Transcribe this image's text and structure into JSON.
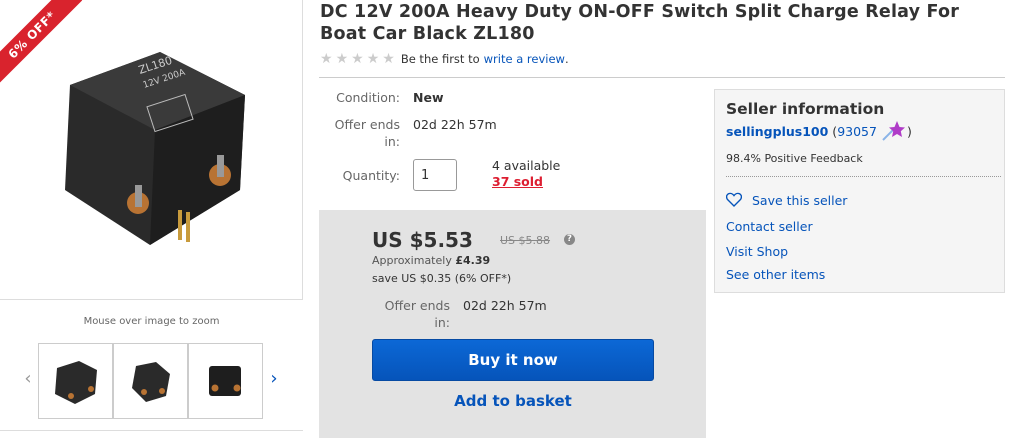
{
  "image": {
    "ribbon": "6% OFF*",
    "zoom_hint": "Mouse over image to zoom",
    "relay_top_label": "ZL180",
    "relay_sub_label": "12V 200A"
  },
  "title": "DC 12V 200A Heavy Duty ON-OFF Switch Split Charge Relay For Boat Car Black ZL180",
  "rating": {
    "stars": 5,
    "prefix": "Be the first to",
    "link": "write a review",
    "suffix": "."
  },
  "details": {
    "condition_label": "Condition:",
    "condition_value": "New",
    "offer_label_1": "Offer ends",
    "offer_label_2": "in:",
    "offer_value": "02d 22h 57m",
    "quantity_label": "Quantity:",
    "quantity_value": "1",
    "available": "4 available",
    "sold": "37 sold"
  },
  "price": {
    "main": "US $5.53",
    "was": "US $5.88",
    "approx_prefix": "Approximately",
    "approx_value": "£4.39",
    "save": "save US $0.35 (6% OFF*)",
    "offer_label_1": "Offer ends",
    "offer_label_2": "in:",
    "offer_value": "02d 22h 57m",
    "buy_now": "Buy it now",
    "add_basket": "Add to basket"
  },
  "seller": {
    "title": "Seller information",
    "name": "sellingplus100",
    "score_open": "(",
    "score": "93057",
    "score_close": ")",
    "feedback": "98.4% Positive Feedback",
    "save_seller": "Save this seller",
    "contact": "Contact seller",
    "visit_shop": "Visit Shop",
    "other_items": "See other items"
  },
  "colors": {
    "link": "#0654ba",
    "ribbon": "#d9232d",
    "sold": "#dd1e31",
    "price_panel": "#e3e3e3"
  }
}
